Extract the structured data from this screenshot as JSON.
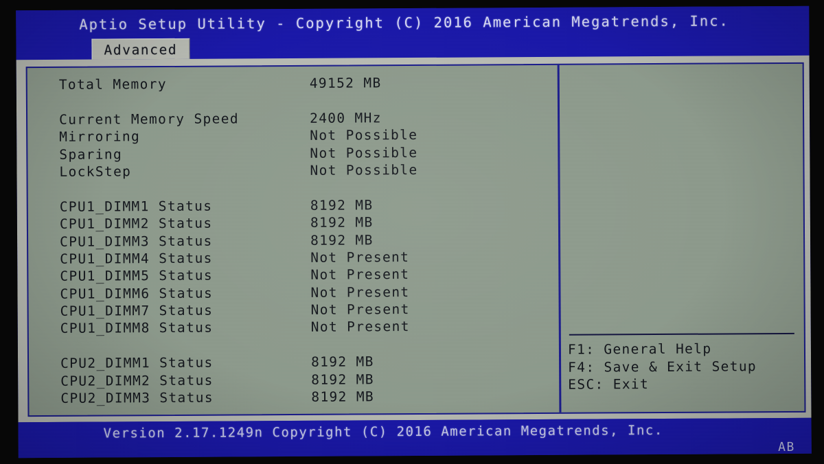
{
  "header": {
    "title": "Aptio Setup Utility - Copyright (C) 2016 American Megatrends, Inc.",
    "active_tab": "Advanced"
  },
  "main": {
    "rows": [
      {
        "label": "Total Memory",
        "value": "49152 MB"
      },
      {
        "label": "",
        "value": ""
      },
      {
        "label": "Current Memory Speed",
        "value": "2400 MHz"
      },
      {
        "label": "Mirroring",
        "value": "Not Possible"
      },
      {
        "label": "Sparing",
        "value": "Not Possible"
      },
      {
        "label": "LockStep",
        "value": "Not Possible"
      },
      {
        "label": "",
        "value": ""
      },
      {
        "label": "CPU1_DIMM1 Status",
        "value": "8192 MB"
      },
      {
        "label": "CPU1_DIMM2 Status",
        "value": "8192 MB"
      },
      {
        "label": "CPU1_DIMM3 Status",
        "value": "8192 MB"
      },
      {
        "label": "CPU1_DIMM4 Status",
        "value": "Not Present"
      },
      {
        "label": "CPU1_DIMM5 Status",
        "value": "Not Present"
      },
      {
        "label": "CPU1_DIMM6 Status",
        "value": "Not Present"
      },
      {
        "label": "CPU1_DIMM7 Status",
        "value": "Not Present"
      },
      {
        "label": "CPU1_DIMM8 Status",
        "value": "Not Present"
      },
      {
        "label": "",
        "value": ""
      },
      {
        "label": "CPU2_DIMM1 Status",
        "value": "8192 MB"
      },
      {
        "label": "CPU2_DIMM2 Status",
        "value": "8192 MB"
      },
      {
        "label": "CPU2_DIMM3 Status",
        "value": "8192 MB"
      }
    ]
  },
  "scrollbar": {
    "up_arrow_icon": "triangle-up-icon",
    "down_arrow_icon": "triangle-down-icon"
  },
  "help": {
    "keys": [
      "F1: General Help",
      "F4: Save & Exit Setup",
      "ESC: Exit"
    ]
  },
  "footer": {
    "version": "Version 2.17.1249n Copyright (C) 2016 American Megatrends, Inc.",
    "code": "AB"
  },
  "colors": {
    "header_blue": "#1a18a8",
    "panel_bg": "#8d9a8c",
    "frame_grey": "#b7bab2",
    "border_blue": "#1b1c8c",
    "text_dark": "#13161c",
    "text_light": "#d7d9f2"
  }
}
